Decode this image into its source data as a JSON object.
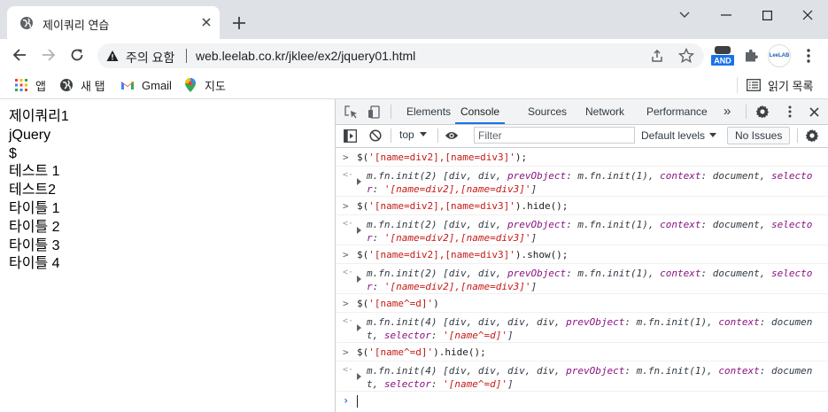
{
  "browser": {
    "tab": {
      "title": "제이쿼리 연습"
    },
    "address_bar": {
      "security_label": "주의 요함",
      "url": "web.leelab.co.kr/jklee/ex2/jquery01.html"
    },
    "extensions": {
      "and_label": "AND",
      "profile_label": "LeeLAB"
    },
    "bookmarks": [
      {
        "label": "앱",
        "icon": "apps-grid-icon"
      },
      {
        "label": "새 탭",
        "icon": "globe-icon"
      },
      {
        "label": "Gmail",
        "icon": "gmail-icon"
      },
      {
        "label": "지도",
        "icon": "maps-pin-icon"
      }
    ],
    "reading_list": "읽기 목록"
  },
  "page": {
    "lines": [
      "제이쿼리1",
      "jQuery",
      "$",
      "테스트 1",
      "테스트2",
      "타이틀 1",
      "타이틀 2",
      "타이틀 3",
      "타이틀 4"
    ]
  },
  "devtools": {
    "tabs": [
      "Elements",
      "Console",
      "Sources",
      "Network",
      "Performance"
    ],
    "active_tab": "Console",
    "more_tabs": "»",
    "console_toolbar": {
      "context": "top",
      "filter_placeholder": "Filter",
      "levels": "Default levels",
      "issues": "No Issues"
    },
    "entries": [
      {
        "input": "$('[name=div2],[name=div3]');",
        "output": "m.fn.init(2) [div, div, prevObject: m.fn.init(1), context: document, selector: '[name=div2],[name=div3]']"
      },
      {
        "input": "$('[name=div2],[name=div3]').hide();",
        "output": "m.fn.init(2) [div, div, prevObject: m.fn.init(1), context: document, selector: '[name=div2],[name=div3]']"
      },
      {
        "input": "$('[name=div2],[name=div3]').show();",
        "output": "m.fn.init(2) [div, div, prevObject: m.fn.init(1), context: document, selector: '[name=div2],[name=div3]']"
      },
      {
        "input": "$('[name^=d]')",
        "output": "m.fn.init(4) [div, div, div, div, prevObject: m.fn.init(1), context: document, selector: '[name^=d]']"
      },
      {
        "input": "$('[name^=d]').hide();",
        "output": "m.fn.init(4) [div, div, div, div, prevObject: m.fn.init(1), context: document, selector: '[name^=d]']"
      }
    ]
  },
  "colors": {
    "accent": "#1a73e8",
    "string": "#c41a16",
    "keyword": "#881280"
  }
}
